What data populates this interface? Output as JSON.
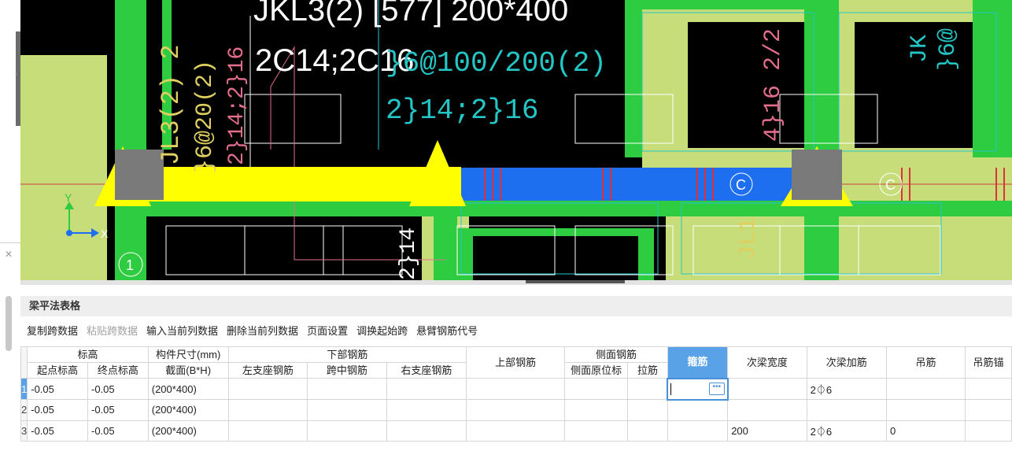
{
  "cad": {
    "beam_label": "JKL3(2) [577] 200*400",
    "beam_rebar": "2C14;2C16",
    "teal_texts": [
      "}6@100/200(2)",
      "2}14;2}16"
    ],
    "left_texts": [
      "JL3(2) 2",
      "}6@20(2)",
      "2}14;2}16"
    ],
    "right_texts": [
      "4}16 2/2",
      "JK",
      "}6@"
    ],
    "lower_texts": [
      "2}14",
      "JL1"
    ],
    "axis_label_1": "1",
    "axis_label_c1": "C",
    "axis_label_c2": "C",
    "axis_y": "Y",
    "axis_x": "X",
    "colors": {
      "canvas_bg": "#000000",
      "beam_green": "#2ecc40",
      "slab_green": "#c6dd7a",
      "selected_beam": "#ffff00",
      "beam_blue": "#1e6ff0",
      "column_gray": "#7a7a7a",
      "active_header": "#5aa2e8"
    }
  },
  "panel": {
    "title": "梁平法表格",
    "toolbar": [
      {
        "label": "复制跨数据",
        "enabled": true
      },
      {
        "label": "粘贴跨数据",
        "enabled": false
      },
      {
        "label": "输入当前列数据",
        "enabled": true
      },
      {
        "label": "删除当前列数据",
        "enabled": true
      },
      {
        "label": "页面设置",
        "enabled": true
      },
      {
        "label": "调换起始跨",
        "enabled": true
      },
      {
        "label": "悬臂钢筋代号",
        "enabled": true
      }
    ],
    "headers": {
      "group_elevation": "标高",
      "group_size": "构件尺寸(mm)",
      "group_bottom": "下部钢筋",
      "top_rebar": "上部钢筋",
      "group_side": "侧面钢筋",
      "stirrup": "箍筋",
      "sec_beam_width": "次梁宽度",
      "sec_beam_rebar": "次梁加筋",
      "hanger": "吊筋",
      "hanger_anchor": "吊筋锚",
      "start_elev": "起点标高",
      "end_elev": "终点标高",
      "section": "截面(B*H)",
      "left_support": "左支座钢筋",
      "mid_span": "跨中钢筋",
      "right_support": "右支座钢筋",
      "side_original": "侧面原位标",
      "tie": "拉筋"
    },
    "rows": [
      {
        "num": "1",
        "start": "-0.05",
        "end": "-0.05",
        "section": "(200*400)",
        "left": "",
        "mid": "",
        "right": "",
        "top": "",
        "side": "",
        "tie": "",
        "stirrup": "",
        "sec_width": "",
        "sec_rebar": "2⏀6",
        "hanger": "",
        "hanger_anchor": ""
      },
      {
        "num": "2",
        "start": "-0.05",
        "end": "-0.05",
        "section": "(200*400)",
        "left": "",
        "mid": "",
        "right": "",
        "top": "",
        "side": "",
        "tie": "",
        "stirrup": "",
        "sec_width": "",
        "sec_rebar": "",
        "hanger": "",
        "hanger_anchor": ""
      },
      {
        "num": "3",
        "start": "-0.05",
        "end": "-0.05",
        "section": "(200*400)",
        "left": "",
        "mid": "",
        "right": "",
        "top": "",
        "side": "",
        "tie": "",
        "stirrup": "",
        "sec_width": "200",
        "sec_rebar": "2⏀6",
        "hanger": "0",
        "hanger_anchor": ""
      }
    ]
  }
}
